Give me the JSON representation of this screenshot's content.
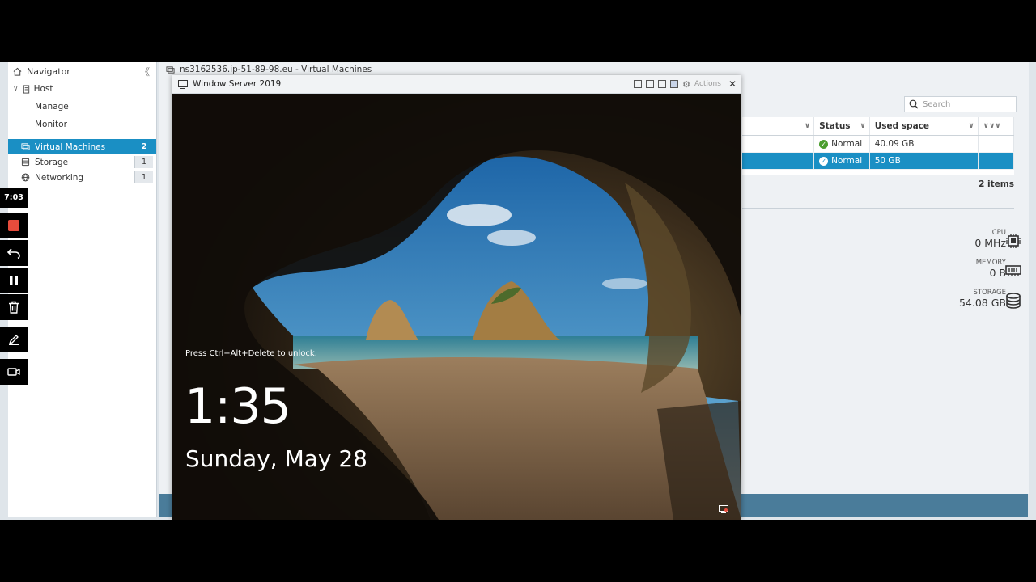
{
  "navigator": {
    "title": "Navigator",
    "host": {
      "label": "Host",
      "children": [
        "Manage",
        "Monitor"
      ]
    },
    "items": [
      {
        "label": "Virtual Machines",
        "count": "2"
      },
      {
        "label": "Storage",
        "count": "1"
      },
      {
        "label": "Networking",
        "count": "1"
      }
    ]
  },
  "panel": {
    "title": "ns3162536.ip-51-89-98.eu - Virtual Machines",
    "search_placeholder": "Search",
    "columns": [
      "Status",
      "Used space"
    ],
    "rows": [
      {
        "status": "Normal",
        "used": "40.09 GB"
      },
      {
        "status": "Normal",
        "used": "50 GB"
      }
    ],
    "items_count": "2 items",
    "resources": {
      "cpu": {
        "label": "CPU",
        "value": "0 MHz"
      },
      "memory": {
        "label": "MEMORY",
        "value": "0 B"
      },
      "storage": {
        "label": "STORAGE",
        "value": "54.08 GB"
      }
    }
  },
  "console": {
    "title": "Window Server 2019",
    "actions_label": "Actions",
    "unlock_hint": "Press Ctrl+Alt+Delete to unlock.",
    "time": "1:35",
    "date": "Sunday, May 28"
  },
  "recorder": {
    "elapsed": "7:03"
  },
  "colors": {
    "accent": "#1a8fc4",
    "status_ok": "#4a9d2e",
    "record": "#e74c3c"
  }
}
